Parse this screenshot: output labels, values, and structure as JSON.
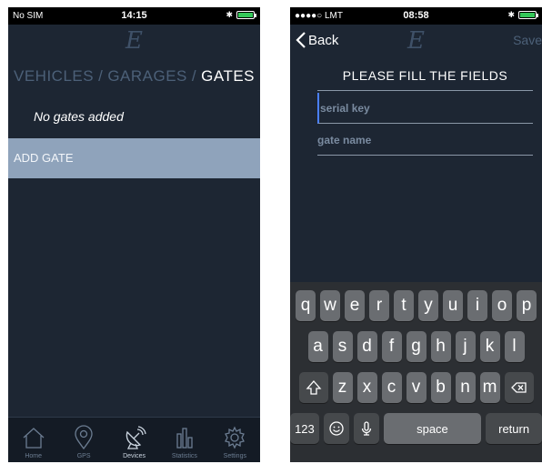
{
  "left": {
    "status": {
      "carrier": "No SIM",
      "time": "14:15"
    },
    "logo": "E",
    "tabs": [
      {
        "label": "VEHICLES"
      },
      {
        "label": "GARAGES"
      },
      {
        "label": "GATES"
      }
    ],
    "separator": "/",
    "empty_message": "No gates added",
    "add_gate_label": "ADD GATE",
    "tabbar": [
      {
        "label": "Home",
        "icon": "home-icon"
      },
      {
        "label": "GPS",
        "icon": "location-pin-icon"
      },
      {
        "label": "Devices",
        "icon": "satellite-dish-icon"
      },
      {
        "label": "Statistics",
        "icon": "bar-chart-icon"
      },
      {
        "label": "Settings",
        "icon": "gear-icon"
      }
    ]
  },
  "right": {
    "status": {
      "carrier": "●●●●○ LMT",
      "time": "08:58"
    },
    "back_label": "Back",
    "logo": "E",
    "save_label": "Save",
    "form_title": "PLEASE FILL THE FIELDS",
    "fields": {
      "serial_placeholder": "serial key",
      "gate_placeholder": "gate name"
    },
    "keyboard": {
      "row1": [
        "q",
        "w",
        "e",
        "r",
        "t",
        "y",
        "u",
        "i",
        "o",
        "p"
      ],
      "row2": [
        "a",
        "s",
        "d",
        "f",
        "g",
        "h",
        "j",
        "k",
        "l"
      ],
      "row3": [
        "z",
        "x",
        "c",
        "v",
        "b",
        "n",
        "m"
      ],
      "numbers_label": "123",
      "space_label": "space",
      "return_label": "return"
    }
  },
  "colors": {
    "background": "#1d2633",
    "accent_row": "#8fa3bb",
    "inactive_text": "#4c6078",
    "keyboard_bg": "#2c2f33",
    "key_bg": "#6a6d71"
  }
}
